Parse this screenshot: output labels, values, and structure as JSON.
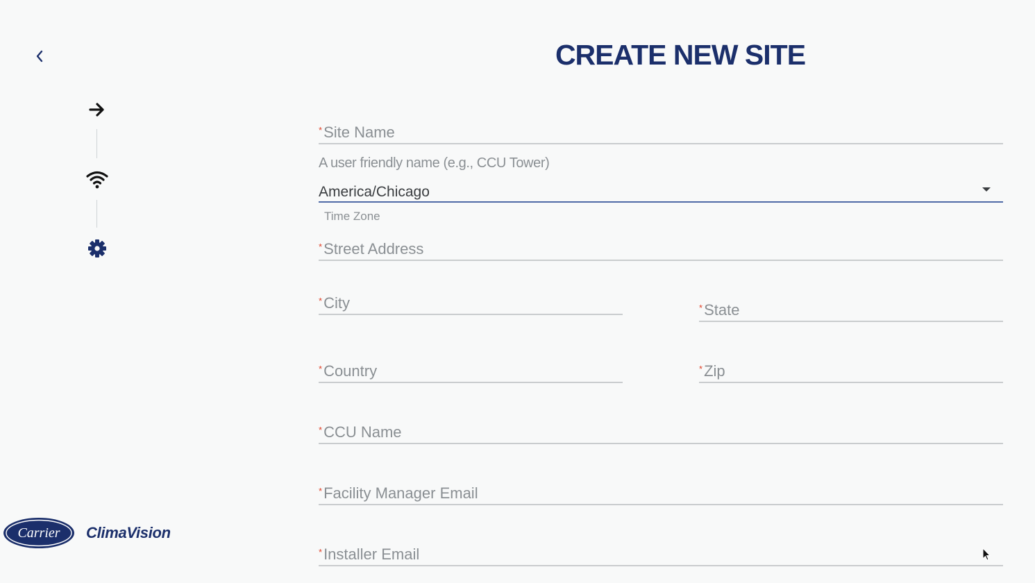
{
  "header": {
    "title": "CREATE NEW SITE"
  },
  "stepper": {
    "steps": [
      {
        "icon": "arrow-right-icon"
      },
      {
        "icon": "wifi-icon"
      },
      {
        "icon": "gear-icon"
      }
    ]
  },
  "brand": {
    "logo_text": "Carrier",
    "product": "ClimaVision",
    "color": "#1b2f6b"
  },
  "form": {
    "required_marker": "*",
    "site_name": {
      "label": "Site Name",
      "helper": "A user friendly name (e.g., CCU Tower)"
    },
    "time_zone": {
      "value": "America/Chicago",
      "helper": "Time Zone"
    },
    "street_address": {
      "label": "Street Address"
    },
    "city": {
      "label": "City"
    },
    "state": {
      "label": "State"
    },
    "country": {
      "label": "Country"
    },
    "zip": {
      "label": "Zip"
    },
    "ccu_name": {
      "label": "CCU Name"
    },
    "facility_manager_email": {
      "label": "Facility Manager Email"
    },
    "installer_email": {
      "label": "Installer Email"
    }
  },
  "colors": {
    "title": "#1b2f6b",
    "required": "#e0442b",
    "label": "#8a8f93",
    "active_underline": "#4f6aa6"
  }
}
